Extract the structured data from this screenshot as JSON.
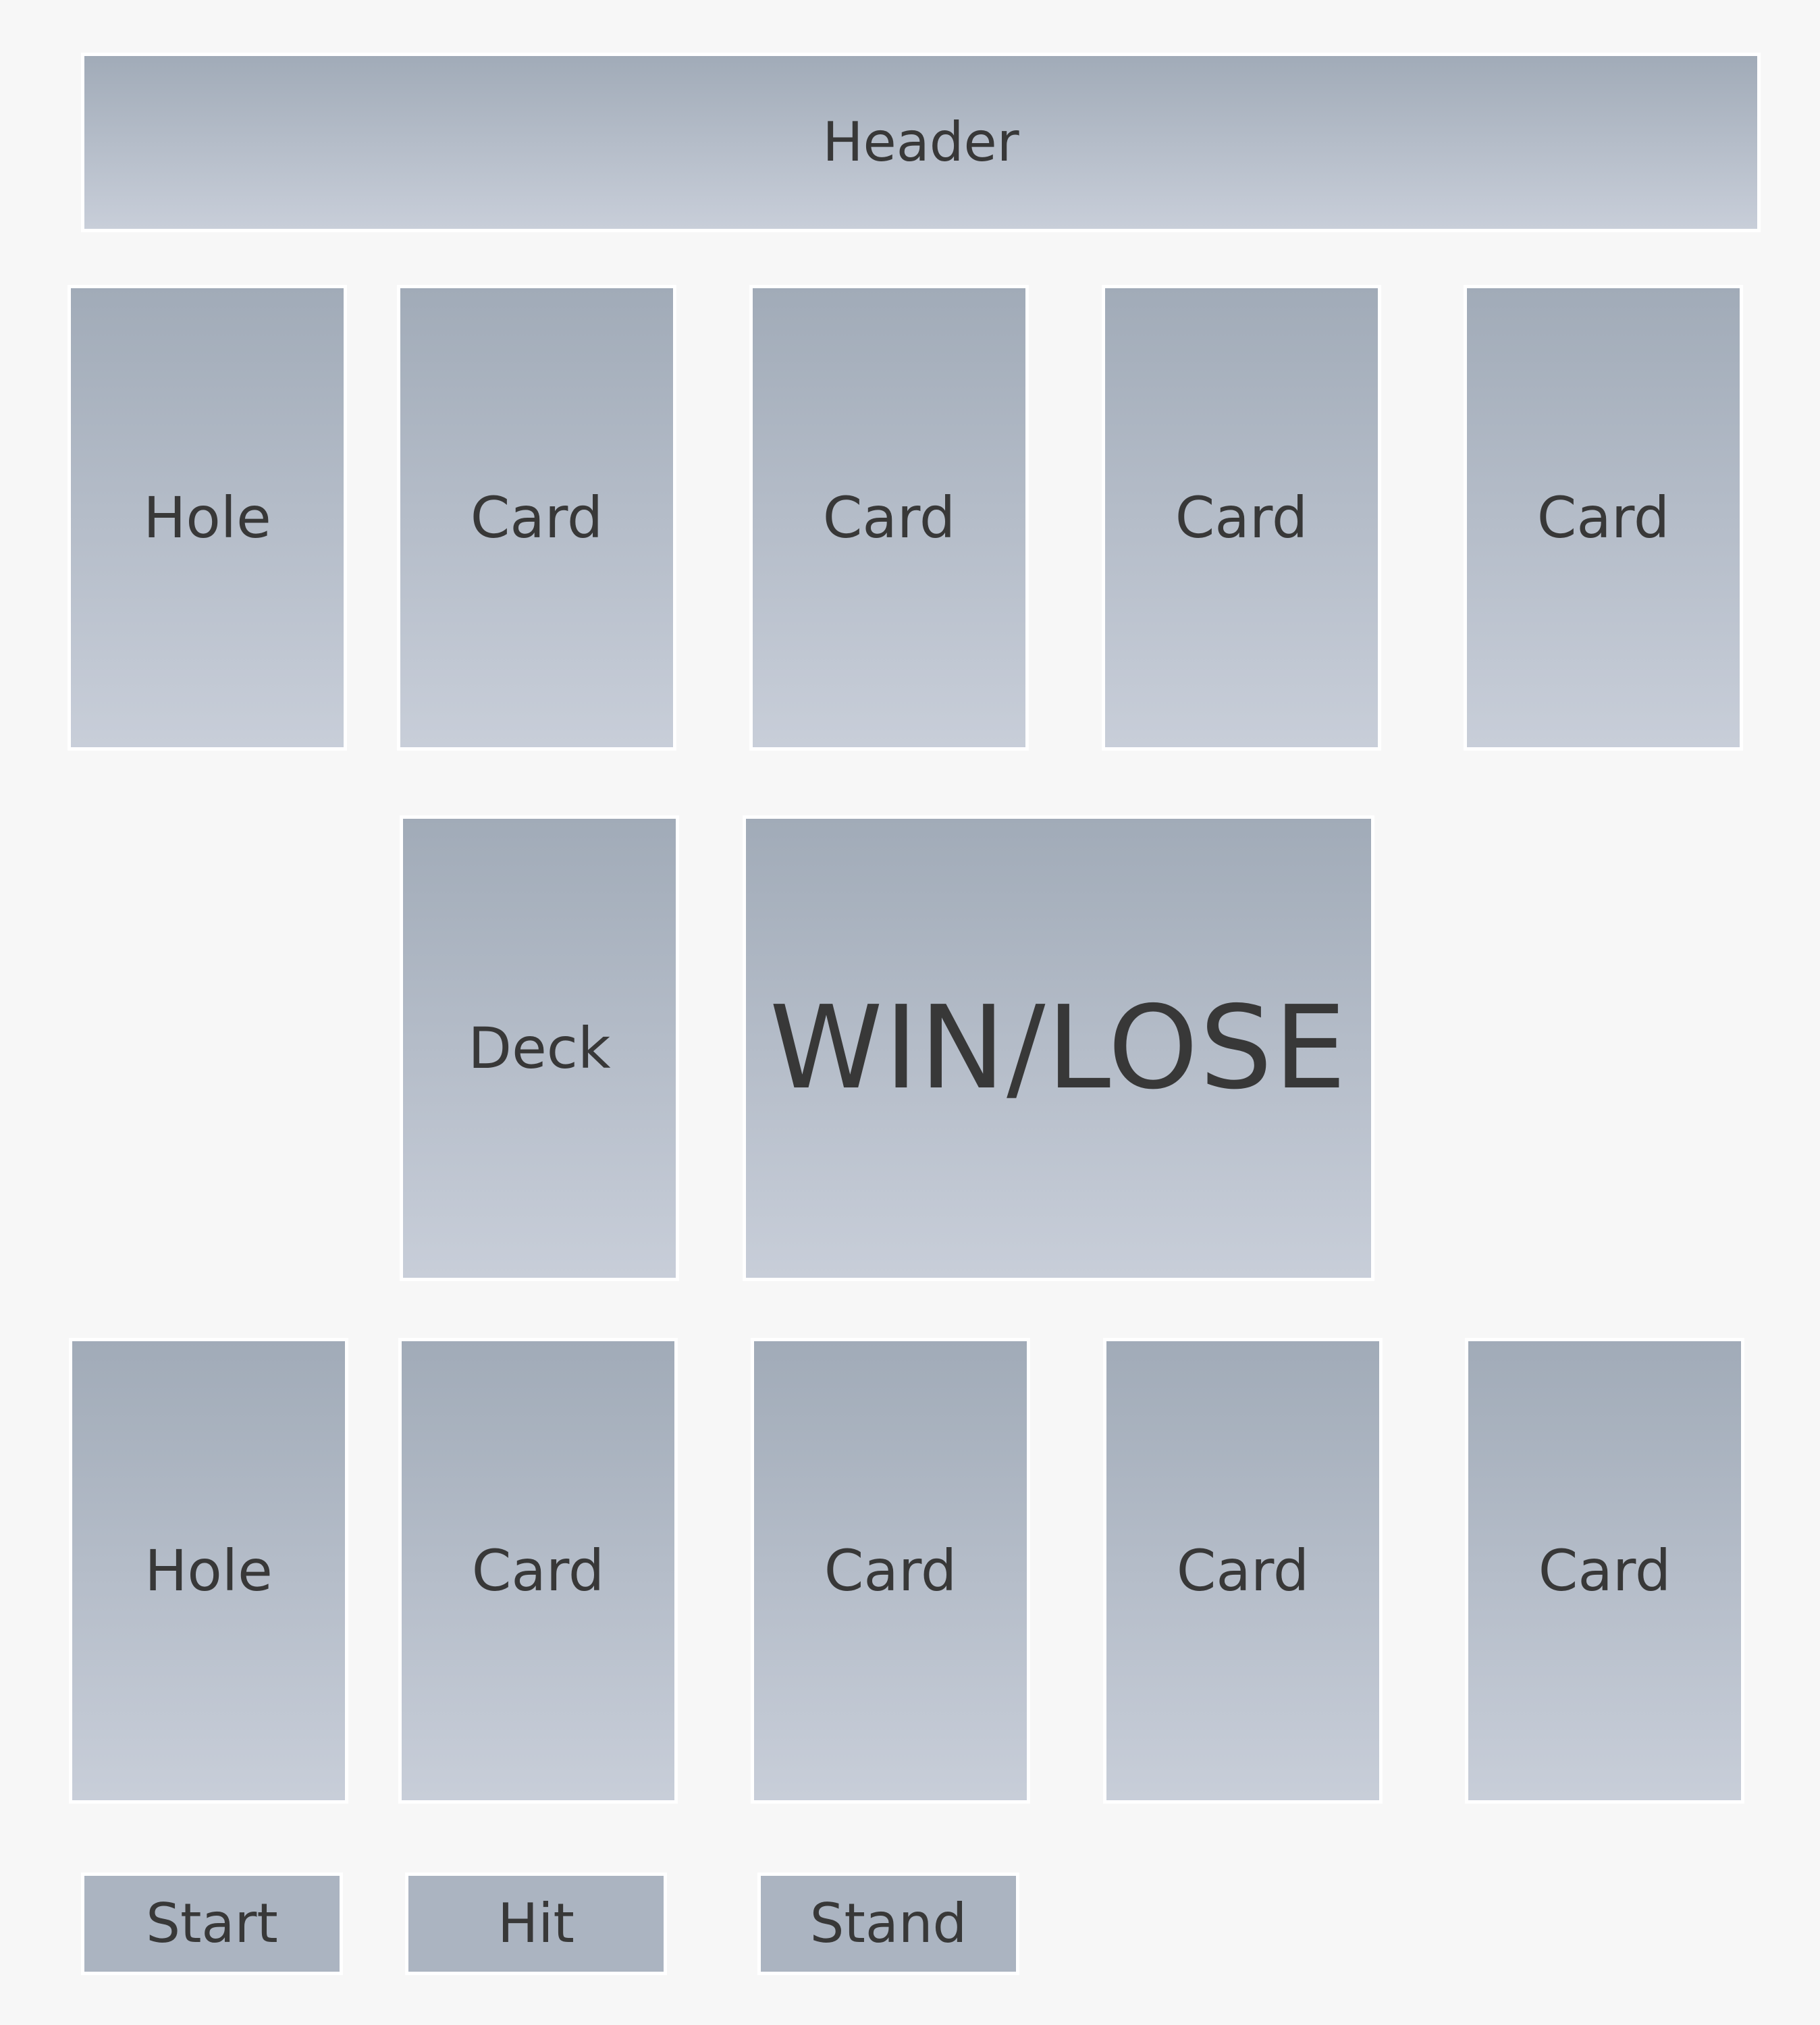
{
  "header": {
    "title": "Header"
  },
  "dealer": {
    "hole_label": "Hole",
    "cards": [
      "Card",
      "Card",
      "Card",
      "Card"
    ]
  },
  "table": {
    "deck_label": "Deck",
    "result_label": "WIN/LOSE"
  },
  "player": {
    "hole_label": "Hole",
    "cards": [
      "Card",
      "Card",
      "Card",
      "Card"
    ]
  },
  "controls": {
    "start_label": "Start",
    "hit_label": "Hit",
    "stand_label": "Stand"
  }
}
